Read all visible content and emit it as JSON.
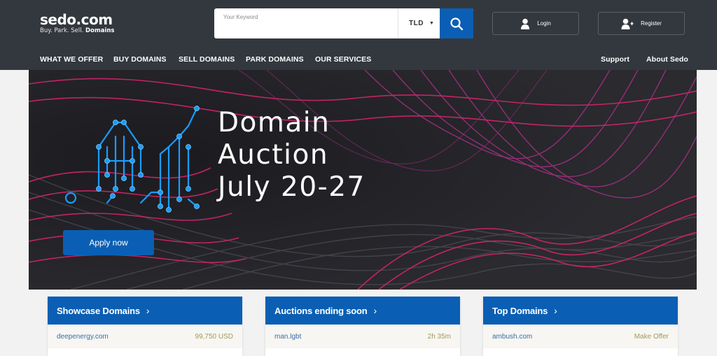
{
  "logo": {
    "name": "sedo.com",
    "tagline_plain": "Buy.  Park.  Sell. ",
    "tagline_bold": "Domains"
  },
  "search": {
    "label": "Your Keyword",
    "value": "",
    "tld_label": "TLD",
    "icon": "search-icon"
  },
  "account": {
    "login_label": "Login",
    "register_label": "Register"
  },
  "nav": {
    "items": [
      "WHAT WE OFFER",
      "BUY DOMAINS",
      "SELL DOMAINS",
      "PARK DOMAINS",
      "OUR SERVICES"
    ],
    "right_items": [
      "Support",
      "About Sedo"
    ]
  },
  "banner": {
    "headline": [
      "Domain",
      "Auction",
      "July 20-27"
    ],
    "cta_label": "Apply now"
  },
  "cards": [
    {
      "title": "Showcase Domains",
      "rows": [
        {
          "domain": "deepenergy.com",
          "value": "99,750 USD"
        }
      ]
    },
    {
      "title": "Auctions ending soon",
      "rows": [
        {
          "domain": "man.lgbt",
          "value": "2h 35m"
        }
      ]
    },
    {
      "title": "Top Domains",
      "rows": [
        {
          "domain": "ambush.com",
          "value": "Make Offer"
        }
      ]
    }
  ],
  "colors": {
    "header_bg": "#33383f",
    "accent_blue": "#0a5fb4",
    "banner_bg": "#232327",
    "wave_pink": "#d4246a",
    "glow_blue": "#1a9cff",
    "value_gold": "#a39a5a"
  }
}
